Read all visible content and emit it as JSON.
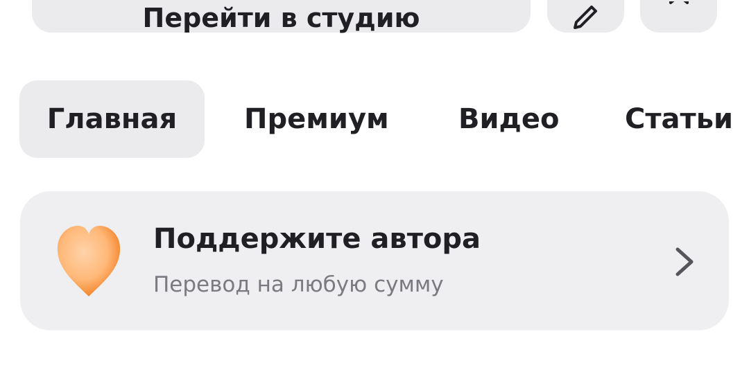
{
  "top_actions": {
    "studio_label": "Перейти в студию",
    "edit_icon": "pencil-icon",
    "bookmark_icon": "bookmark-icon"
  },
  "tabs": [
    {
      "label": "Главная",
      "active": true
    },
    {
      "label": "Премиум",
      "active": false
    },
    {
      "label": "Видео",
      "active": false
    },
    {
      "label": "Статьи",
      "active": false
    }
  ],
  "support_card": {
    "icon": "heart-icon",
    "title": "Поддержите автора",
    "subtitle": "Перевод на любую сумму",
    "chevron_icon": "chevron-right-icon"
  },
  "colors": {
    "button_bg": "#ebebee",
    "card_bg": "#efeff2",
    "text_primary": "#1f1f24",
    "text_secondary": "#7a7a80",
    "heart_orange": "#f7a15a"
  }
}
